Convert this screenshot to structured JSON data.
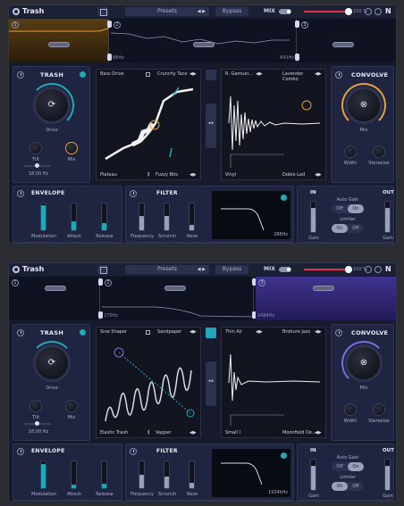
{
  "colors": {
    "accent_teal": "#21a8b8",
    "accent_orange": "#e6a23c",
    "accent_purple": "#7c6ed8",
    "mix_red": "#e0334f",
    "bg": "#161a2b"
  },
  "instances": [
    {
      "id": "a",
      "topbar": {
        "title": "Trash",
        "presets": "Presets",
        "bypass": "Bypass",
        "mix": "MIX",
        "mix_value": "100 %",
        "mix_fraction": 0.93,
        "logo_letter": "N"
      },
      "timeline": {
        "segments": [
          {
            "num": "1"
          },
          {
            "num": "2"
          },
          {
            "num": "3"
          }
        ],
        "freqs": [
          "88Hz",
          "843Hz"
        ],
        "highlight_color": "#c98a24"
      },
      "trash": {
        "title": "TRASH",
        "drive": "Drive",
        "tilt": "Tilt",
        "mix": "Mix",
        "tilt_value": "18.00 Hz"
      },
      "distortion": {
        "left_top": "Bass Drive",
        "right_top": "Crunchy Taco",
        "left_bottom": "Plateau",
        "right_bottom": "Fuzzy Bits"
      },
      "convolve_graph": {
        "left_top": "R. Gamuel...",
        "right_top": "Lavender Combo",
        "left_bottom": "Vinyl",
        "right_bottom": "Dobie Lad"
      },
      "convolve": {
        "title": "CONVOLVE",
        "mix": "Mix",
        "width": "Width",
        "stereoize": "Stereoize",
        "arc_color": "#e6a23c"
      },
      "envelope": {
        "title": "ENVELOPE",
        "labels": [
          "Modulation",
          "Attack",
          "Release"
        ],
        "levels": [
          0.95,
          0.35,
          0.28
        ]
      },
      "filter": {
        "title": "FILTER",
        "labels": [
          "Frequency",
          "Scrunch",
          "Reso"
        ],
        "levels": [
          0.55,
          0.55,
          0.2
        ],
        "readout": "288Hz"
      },
      "io": {
        "in": "IN",
        "out": "OUT",
        "gain": "Gain",
        "auto_gain": "Auto Gain",
        "limiter": "Limiter",
        "on": "On",
        "off": "Off",
        "in_level": 0.8,
        "out_level": 0.8
      }
    },
    {
      "id": "b",
      "topbar": {
        "title": "Trash",
        "presets": "Presets",
        "bypass": "Bypass",
        "mix": "MIX",
        "mix_value": "100 %",
        "mix_fraction": 0.93,
        "logo_letter": "N"
      },
      "timeline": {
        "segments": [
          {
            "num": "1"
          },
          {
            "num": "2"
          },
          {
            "num": "3"
          }
        ],
        "freqs": [
          "270Hz",
          "2484Hz"
        ],
        "highlight_color": "#5a4ac2"
      },
      "trash": {
        "title": "TRASH",
        "drive": "Drive",
        "tilt": "Tilt",
        "mix": "Mix",
        "tilt_value": "18.00 Hz"
      },
      "distortion": {
        "left_top": "Sine Shaper",
        "right_top": "Sandpaper",
        "left_bottom": "Elastic Trash",
        "right_bottom": "Vapper"
      },
      "convolve_graph": {
        "left_top": "Thin Air",
        "right_top": "Brohure Jazz",
        "left_bottom": "Small I",
        "right_bottom": "Moonfield De..."
      },
      "convolve": {
        "title": "CONVOLVE",
        "mix": "Mix",
        "width": "Width",
        "stereoize": "Stereoize",
        "arc_color": "#7c6ed8"
      },
      "envelope": {
        "title": "ENVELOPE",
        "labels": [
          "Modulation",
          "Attack",
          "Release"
        ],
        "levels": [
          0.9,
          0.15,
          0.18
        ]
      },
      "filter": {
        "title": "FILTER",
        "labels": [
          "Frequency",
          "Scrunch",
          "Reso"
        ],
        "levels": [
          0.5,
          0.45,
          0.2
        ],
        "readout": "1924kHz"
      },
      "io": {
        "in": "IN",
        "out": "OUT",
        "gain": "Gain",
        "auto_gain": "Auto Gain",
        "limiter": "Limiter",
        "on": "On",
        "off": "Off",
        "in_level": 0.8,
        "out_level": 0.8
      }
    }
  ]
}
